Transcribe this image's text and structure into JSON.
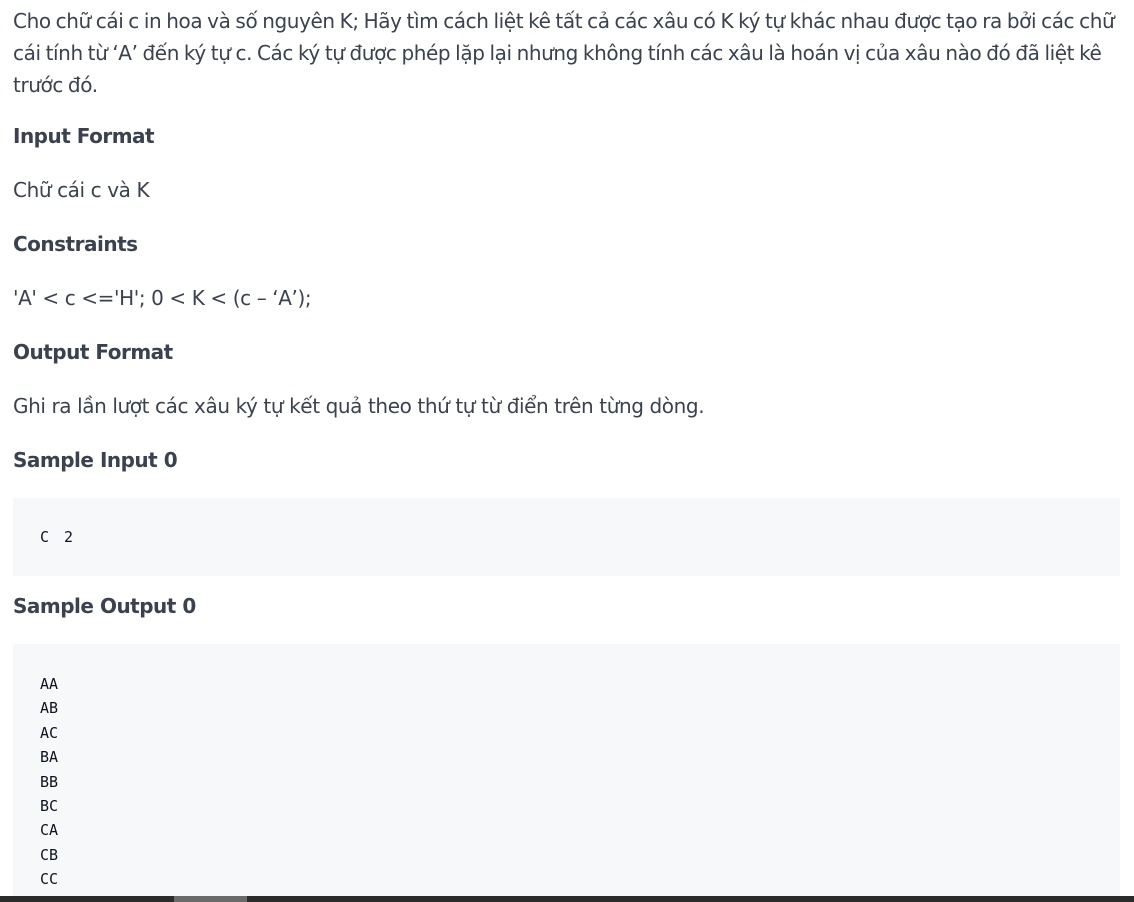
{
  "problem": {
    "statement": "Cho chữ cái c in hoa và số nguyên K; Hãy tìm cách liệt kê tất cả các xâu có K ký tự khác nhau được tạo ra bởi các chữ cái tính từ ‘A’ đến ký tự c. Các ký tự được phép lặp lại nhưng không tính các xâu là hoán vị của xâu nào đó đã liệt kê trước đó."
  },
  "input_format": {
    "title": "Input Format",
    "text": "Chữ cái c và K"
  },
  "constraints": {
    "title": "Constraints",
    "text": "'A' < c <='H'; 0 < K < (c – ‘A’);"
  },
  "output_format": {
    "title": "Output Format",
    "text": "Ghi ra lần lượt các xâu ký tự kết quả theo thứ tự từ điển trên từng dòng."
  },
  "sample_input": {
    "title": "Sample Input 0",
    "lines": [
      "C 2"
    ]
  },
  "sample_output": {
    "title": "Sample Output 0",
    "lines": [
      "AA",
      "AB",
      "AC",
      "BA",
      "BB",
      "BC",
      "CA",
      "CB",
      "CC"
    ]
  }
}
